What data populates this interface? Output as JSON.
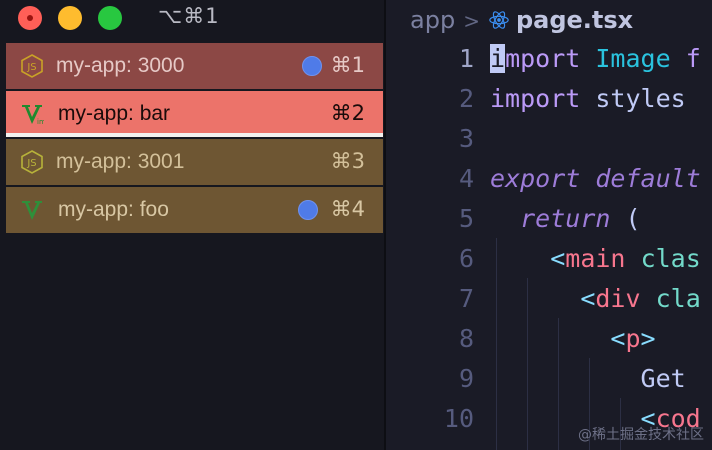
{
  "window": {
    "shortcut": "⌥⌘1",
    "controls": [
      "close",
      "minimize",
      "zoom"
    ]
  },
  "tabs": [
    {
      "icon": "nodejs-icon",
      "label": "my-app: 3000",
      "activity_dot": true,
      "shortcut": "⌘1",
      "color": "#8c4845"
    },
    {
      "icon": "vim-icon",
      "label": "my-app: bar",
      "activity_dot": false,
      "shortcut": "⌘2",
      "color": "#ec736a",
      "active": true
    },
    {
      "icon": "nodejs-icon",
      "label": "my-app: 3001",
      "activity_dot": false,
      "shortcut": "⌘3",
      "color": "#6e5633"
    },
    {
      "icon": "vim-icon",
      "label": "my-app: foo",
      "activity_dot": true,
      "shortcut": "⌘4",
      "color": "#6e5633"
    }
  ],
  "editor": {
    "breadcrumb": {
      "folder": "app",
      "file": "page.tsx",
      "file_icon": "react-icon"
    },
    "lines": [
      {
        "n": "1",
        "tokens": [
          [
            "cursor",
            "i"
          ],
          [
            "kw",
            "mport "
          ],
          [
            "type",
            "Image "
          ],
          [
            "kw",
            "f"
          ]
        ]
      },
      {
        "n": "2",
        "tokens": [
          [
            "kw",
            "import "
          ],
          [
            "ident",
            "styles"
          ]
        ]
      },
      {
        "n": "3",
        "tokens": []
      },
      {
        "n": "4",
        "tokens": [
          [
            "kwi",
            "export default"
          ]
        ]
      },
      {
        "n": "5",
        "tokens": [
          [
            "ident",
            "  "
          ],
          [
            "kwi",
            "return"
          ],
          [
            "ident",
            " ("
          ]
        ]
      },
      {
        "n": "6",
        "tokens": [
          [
            "ident",
            "    "
          ],
          [
            "punc",
            "<"
          ],
          [
            "tag",
            "main"
          ],
          [
            "ident",
            " "
          ],
          [
            "attr",
            "clas"
          ]
        ]
      },
      {
        "n": "7",
        "tokens": [
          [
            "ident",
            "      "
          ],
          [
            "punc",
            "<"
          ],
          [
            "tag",
            "div"
          ],
          [
            "ident",
            " "
          ],
          [
            "attr",
            "cla"
          ]
        ]
      },
      {
        "n": "8",
        "tokens": [
          [
            "ident",
            "        "
          ],
          [
            "punc",
            "<"
          ],
          [
            "tag",
            "p"
          ],
          [
            "punc",
            ">"
          ]
        ]
      },
      {
        "n": "9",
        "tokens": [
          [
            "ident",
            "          Get"
          ]
        ]
      },
      {
        "n": "10",
        "tokens": [
          [
            "ident",
            "          "
          ],
          [
            "punc",
            "<"
          ],
          [
            "tag",
            "cod"
          ]
        ]
      }
    ]
  },
  "watermark": "@稀土掘金技术社区",
  "colors": {
    "background": "#1a1b26",
    "keyword": "#bb9af7",
    "type": "#2ac3de",
    "tag": "#f7768e",
    "attribute": "#73daca",
    "dot": "#4f7be8"
  }
}
